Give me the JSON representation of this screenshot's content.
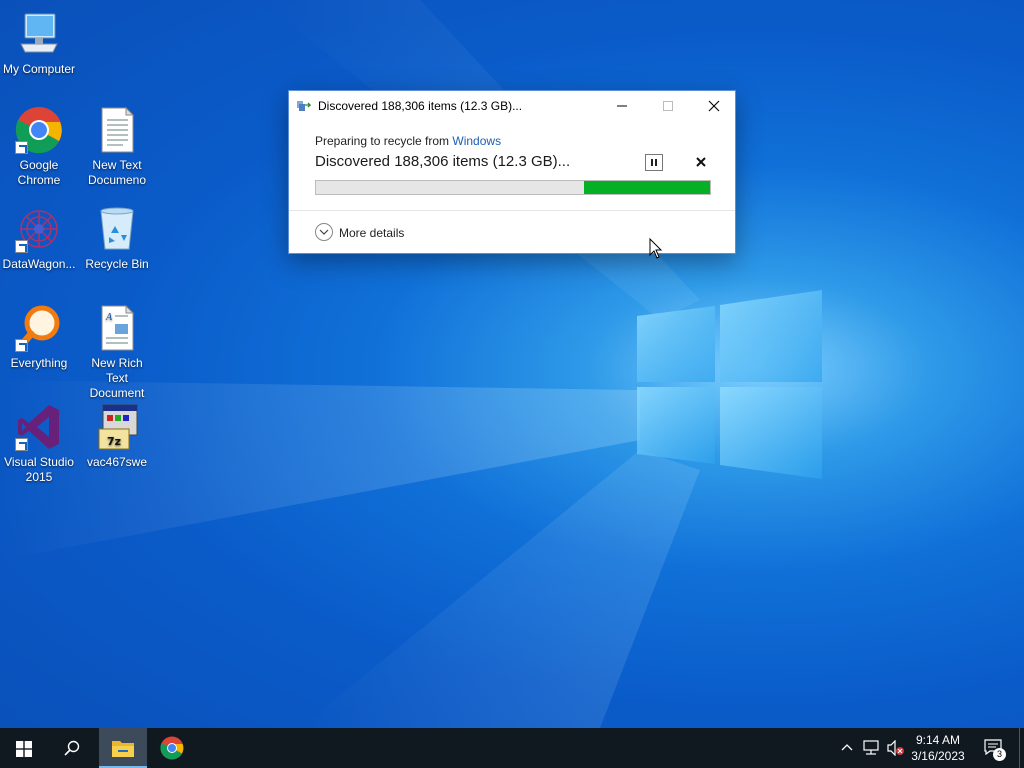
{
  "desktop": {
    "icons": [
      {
        "id": "my-computer",
        "label": "My Computer"
      },
      {
        "id": "google-chrome",
        "label": "Google Chrome"
      },
      {
        "id": "new-text-document",
        "label": "New Text Documeno"
      },
      {
        "id": "datawagon",
        "label": "DataWagon..."
      },
      {
        "id": "recycle-bin",
        "label": "Recycle Bin"
      },
      {
        "id": "everything",
        "label": "Everything"
      },
      {
        "id": "new-rich-text-document",
        "label": "New Rich Text Document"
      },
      {
        "id": "visual-studio",
        "label": "Visual Studio 2015"
      },
      {
        "id": "vac467swe",
        "label": "vac467swe"
      }
    ]
  },
  "dialog": {
    "title": "Discovered 188,306 items (12.3 GB)...",
    "preparing_prefix": "Preparing to recycle from ",
    "source_link": "Windows",
    "status": "Discovered 188,306 items (12.3 GB)...",
    "progress_percent": 32,
    "more_details": "More details"
  },
  "taskbar": {
    "time": "9:14 AM",
    "date": "3/16/2023",
    "notification_count": "3"
  },
  "colors": {
    "progress_fill": "#06b025",
    "link": "#1a5fb4",
    "taskbar": "#101820"
  }
}
